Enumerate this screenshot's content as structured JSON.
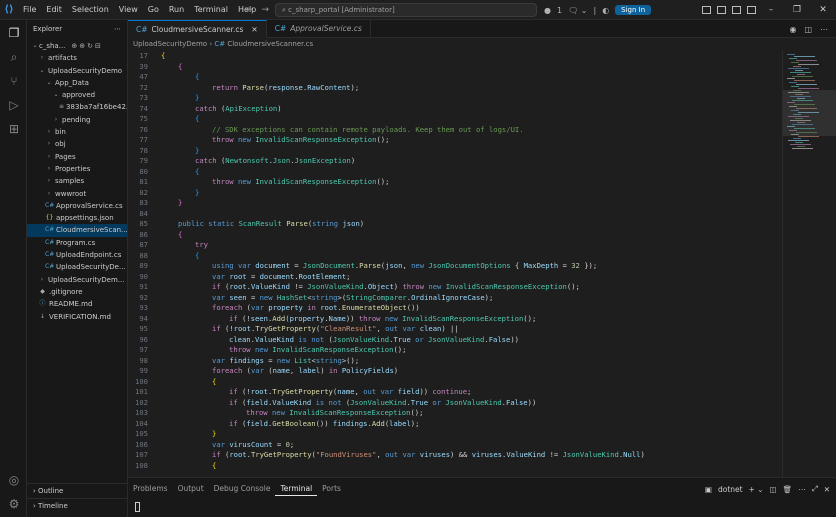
{
  "menu": [
    "File",
    "Edit",
    "Selection",
    "View",
    "Go",
    "Run",
    "Terminal",
    "Help"
  ],
  "search": {
    "text": "c_sharp_portal [Administrator]"
  },
  "titlebar": {
    "badge": "1",
    "signin": "Sign In"
  },
  "explorer": {
    "title": "Explorer",
    "root": "c_sha...",
    "items": [
      {
        "label": "artifacts",
        "depth": 1,
        "kind": "folder",
        "open": false
      },
      {
        "label": "UploadSecurityDemo",
        "depth": 1,
        "kind": "folder",
        "open": true
      },
      {
        "label": "App_Data",
        "depth": 2,
        "kind": "folder",
        "open": true
      },
      {
        "label": "approved",
        "depth": 3,
        "kind": "folder",
        "open": true
      },
      {
        "label": "383ba7af16be42...",
        "depth": 4,
        "kind": "file",
        "icon": "≡"
      },
      {
        "label": "pending",
        "depth": 3,
        "kind": "folder",
        "open": false
      },
      {
        "label": "bin",
        "depth": 2,
        "kind": "folder",
        "open": false
      },
      {
        "label": "obj",
        "depth": 2,
        "kind": "folder",
        "open": false
      },
      {
        "label": "Pages",
        "depth": 2,
        "kind": "folder",
        "open": false
      },
      {
        "label": "Properties",
        "depth": 2,
        "kind": "folder",
        "open": false
      },
      {
        "label": "samples",
        "depth": 2,
        "kind": "folder",
        "open": false
      },
      {
        "label": "wwwroot",
        "depth": 2,
        "kind": "folder",
        "open": false
      },
      {
        "label": "ApprovalService.cs",
        "depth": 2,
        "kind": "file",
        "icon": "C#"
      },
      {
        "label": "appsettings.json",
        "depth": 2,
        "kind": "file",
        "icon": "{}"
      },
      {
        "label": "CloudmersiveScan...",
        "depth": 2,
        "kind": "file",
        "icon": "C#",
        "selected": true
      },
      {
        "label": "Program.cs",
        "depth": 2,
        "kind": "file",
        "icon": "C#"
      },
      {
        "label": "UploadEndpoint.cs",
        "depth": 2,
        "kind": "file",
        "icon": "C#"
      },
      {
        "label": "UploadSecurityDe...",
        "depth": 2,
        "kind": "file",
        "icon": "C#"
      },
      {
        "label": "UploadSecurityDem...",
        "depth": 1,
        "kind": "folder",
        "open": false
      },
      {
        "label": ".gitignore",
        "depth": 1,
        "kind": "file",
        "icon": "◆"
      },
      {
        "label": "README.md",
        "depth": 1,
        "kind": "file",
        "icon": "ⓘ"
      },
      {
        "label": "VERIFICATION.md",
        "depth": 1,
        "kind": "file",
        "icon": "↓"
      }
    ],
    "outline": "Outline",
    "timeline": "Timeline"
  },
  "tabs": [
    {
      "label": "CloudmersiveScanner.cs",
      "active": true
    },
    {
      "label": "ApprovalService.cs",
      "active": false
    }
  ],
  "breadcrumb": {
    "folder": "UploadSecurityDemo",
    "file": "CloudmersiveScanner.cs"
  },
  "code_lines": [
    {
      "n": "17",
      "ind": 0,
      "html": "<span class='br'>{</span>"
    },
    {
      "n": "39",
      "ind": 1,
      "html": "<span class='br2'>{</span>"
    },
    {
      "n": "47",
      "ind": 2,
      "html": "<span class='br3'>{</span>"
    },
    {
      "n": "72",
      "ind": 3,
      "html": "<span class='c'>return</span> <span class='f'>Parse</span>(<span class='v'>response</span>.<span class='v'>RawContent</span>);"
    },
    {
      "n": "73",
      "ind": 2,
      "html": "<span class='br3'>}</span>"
    },
    {
      "n": "74",
      "ind": 2,
      "html": "<span class='c'>catch</span> (<span class='t'>ApiException</span>)"
    },
    {
      "n": "75",
      "ind": 2,
      "html": "<span class='br3'>{</span>"
    },
    {
      "n": "76",
      "ind": 3,
      "html": "<span class='cm'>// SDK exceptions can contain remote payloads. Keep them out of logs/UI.</span>"
    },
    {
      "n": "77",
      "ind": 3,
      "html": "<span class='c'>throw</span> <span class='k'>new</span> <span class='t'>InvalidScanResponseException</span>();"
    },
    {
      "n": "78",
      "ind": 2,
      "html": "<span class='br3'>}</span>"
    },
    {
      "n": "79",
      "ind": 2,
      "html": "<span class='c'>catch</span> (<span class='t'>Newtonsoft</span>.<span class='t'>Json</span>.<span class='t'>JsonException</span>)"
    },
    {
      "n": "80",
      "ind": 2,
      "html": "<span class='br3'>{</span>"
    },
    {
      "n": "81",
      "ind": 3,
      "html": "<span class='c'>throw</span> <span class='k'>new</span> <span class='t'>InvalidScanResponseException</span>();"
    },
    {
      "n": "82",
      "ind": 2,
      "html": "<span class='br3'>}</span>"
    },
    {
      "n": "83",
      "ind": 1,
      "html": "<span class='br2'>}</span>"
    },
    {
      "n": "84",
      "ind": 0,
      "html": ""
    },
    {
      "n": "85",
      "ind": 1,
      "html": "<span class='k'>public</span> <span class='k'>static</span> <span class='t'>ScanResult</span> <span class='f'>Parse</span>(<span class='k'>string</span> <span class='v'>json</span>)"
    },
    {
      "n": "86",
      "ind": 1,
      "html": "<span class='br2'>{</span>"
    },
    {
      "n": "87",
      "ind": 2,
      "html": "<span class='c'>try</span>"
    },
    {
      "n": "88",
      "ind": 2,
      "html": "<span class='br3'>{</span>"
    },
    {
      "n": "89",
      "ind": 3,
      "html": "<span class='k'>using</span> <span class='k'>var</span> <span class='v'>document</span> = <span class='t'>JsonDocument</span>.<span class='f'>Parse</span>(<span class='v'>json</span>, <span class='k'>new</span> <span class='t'>JsonDocumentOptions</span> { <span class='v'>MaxDepth</span> = <span class='n'>32</span> });"
    },
    {
      "n": "90",
      "ind": 3,
      "html": "<span class='k'>var</span> <span class='v'>root</span> = <span class='v'>document</span>.<span class='v'>RootElement</span>;"
    },
    {
      "n": "91",
      "ind": 3,
      "html": "<span class='c'>if</span> (<span class='v'>root</span>.<span class='v'>ValueKind</span> != <span class='t'>JsonValueKind</span>.<span class='v'>Object</span>) <span class='c'>throw</span> <span class='k'>new</span> <span class='t'>InvalidScanResponseException</span>();"
    },
    {
      "n": "92",
      "ind": 3,
      "html": "<span class='k'>var</span> <span class='v'>seen</span> = <span class='k'>new</span> <span class='t'>HashSet</span>&lt;<span class='k'>string</span>&gt;(<span class='t'>StringComparer</span>.<span class='v'>OrdinalIgnoreCase</span>);"
    },
    {
      "n": "93",
      "ind": 3,
      "html": "<span class='c'>foreach</span> (<span class='k'>var</span> <span class='v'>property</span> <span class='c'>in</span> <span class='v'>root</span>.<span class='f'>EnumerateObject</span>())"
    },
    {
      "n": "94",
      "ind": 4,
      "html": "<span class='c'>if</span> (!<span class='v'>seen</span>.<span class='f'>Add</span>(<span class='v'>property</span>.<span class='v'>Name</span>)) <span class='c'>throw</span> <span class='k'>new</span> <span class='t'>InvalidScanResponseException</span>();"
    },
    {
      "n": "95",
      "ind": 3,
      "html": "<span class='c'>if</span> (!<span class='v'>root</span>.<span class='f'>TryGetProperty</span>(<span class='s'>\"CleanResult\"</span>, <span class='k'>out</span> <span class='k'>var</span> <span class='v'>clean</span>) ||"
    },
    {
      "n": "96",
      "ind": 4,
      "html": "<span class='v'>clean</span>.<span class='v'>ValueKind</span> <span class='k'>is not</span> (<span class='t'>JsonValueKind</span>.<span class='v'>True</span> <span class='k'>or</span> <span class='t'>JsonValueKind</span>.<span class='v'>False</span>))"
    },
    {
      "n": "97",
      "ind": 4,
      "html": "<span class='c'>throw</span> <span class='k'>new</span> <span class='t'>InvalidScanResponseException</span>();"
    },
    {
      "n": "98",
      "ind": 3,
      "html": "<span class='k'>var</span> <span class='v'>findings</span> = <span class='k'>new</span> <span class='t'>List</span>&lt;<span class='k'>string</span>&gt;();"
    },
    {
      "n": "99",
      "ind": 3,
      "html": "<span class='c'>foreach</span> (<span class='k'>var</span> (<span class='v'>name</span>, <span class='v'>label</span>) <span class='c'>in</span> <span class='v'>PolicyFields</span>)"
    },
    {
      "n": "100",
      "ind": 3,
      "html": "<span class='br'>{</span>"
    },
    {
      "n": "101",
      "ind": 4,
      "html": "<span class='c'>if</span> (!<span class='v'>root</span>.<span class='f'>TryGetProperty</span>(<span class='v'>name</span>, <span class='k'>out</span> <span class='k'>var</span> <span class='v'>field</span>)) <span class='c'>continue</span>;"
    },
    {
      "n": "102",
      "ind": 4,
      "html": "<span class='c'>if</span> (<span class='v'>field</span>.<span class='v'>ValueKind</span> <span class='k'>is not</span> (<span class='t'>JsonValueKind</span>.<span class='v'>True</span> <span class='k'>or</span> <span class='t'>JsonValueKind</span>.<span class='v'>False</span>))"
    },
    {
      "n": "103",
      "ind": 5,
      "html": "<span class='c'>throw</span> <span class='k'>new</span> <span class='t'>InvalidScanResponseException</span>();"
    },
    {
      "n": "104",
      "ind": 4,
      "html": "<span class='c'>if</span> (<span class='v'>field</span>.<span class='f'>GetBoolean</span>()) <span class='v'>findings</span>.<span class='f'>Add</span>(<span class='v'>label</span>);"
    },
    {
      "n": "105",
      "ind": 3,
      "html": "<span class='br'>}</span>"
    },
    {
      "n": "106",
      "ind": 3,
      "html": "<span class='k'>var</span> <span class='v'>virusCount</span> = <span class='n'>0</span>;"
    },
    {
      "n": "107",
      "ind": 3,
      "html": "<span class='c'>if</span> (<span class='v'>root</span>.<span class='f'>TryGetProperty</span>(<span class='s'>\"FoundViruses\"</span>, <span class='k'>out</span> <span class='k'>var</span> <span class='v'>viruses</span>) &amp;&amp; <span class='v'>viruses</span>.<span class='v'>ValueKind</span> != <span class='t'>JsonValueKind</span>.<span class='v'>Null</span>)"
    },
    {
      "n": "108",
      "ind": 3,
      "html": "<span class='br'>{</span>"
    }
  ],
  "panel": {
    "tabs": [
      "Problems",
      "Output",
      "Debug Console",
      "Terminal",
      "Ports"
    ],
    "active": "Terminal",
    "shell": "dotnet"
  }
}
